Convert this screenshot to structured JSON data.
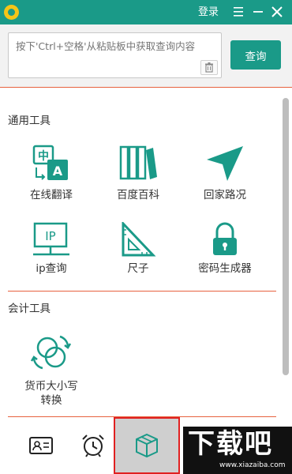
{
  "titlebar": {
    "login_label": "登录",
    "icons": [
      "logo-icon",
      "menu-icon",
      "minimize-icon",
      "close-icon"
    ]
  },
  "search": {
    "placeholder": "按下'Ctrl+空格'从粘贴板中获取查询内容",
    "query_label": "查询"
  },
  "sections": [
    {
      "title": "通用工具",
      "tools": [
        {
          "label": "在线翻译",
          "icon": "translate-icon"
        },
        {
          "label": "百度百科",
          "icon": "books-icon"
        },
        {
          "label": "回家路况",
          "icon": "navigation-arrow-icon"
        },
        {
          "label": "ip查询",
          "icon": "monitor-ip-icon"
        },
        {
          "label": "尺子",
          "icon": "triangle-ruler-icon"
        },
        {
          "label": "密码生成器",
          "icon": "lock-icon"
        }
      ]
    },
    {
      "title": "会计工具",
      "tools": [
        {
          "label_line1": "货币大小写",
          "label_line2": "转换",
          "icon": "currency-convert-icon"
        }
      ]
    }
  ],
  "bottom_tabs": [
    {
      "icon": "id-card-icon",
      "active": false
    },
    {
      "icon": "alarm-clock-icon",
      "active": false
    },
    {
      "icon": "box-icon",
      "active": true
    }
  ],
  "watermark": {
    "text": "下载吧",
    "url_text": "www.xiazaiba.com"
  },
  "colors": {
    "accent": "#1a9a88",
    "divider": "#e7623f",
    "active_tab_border": "#e02020"
  }
}
